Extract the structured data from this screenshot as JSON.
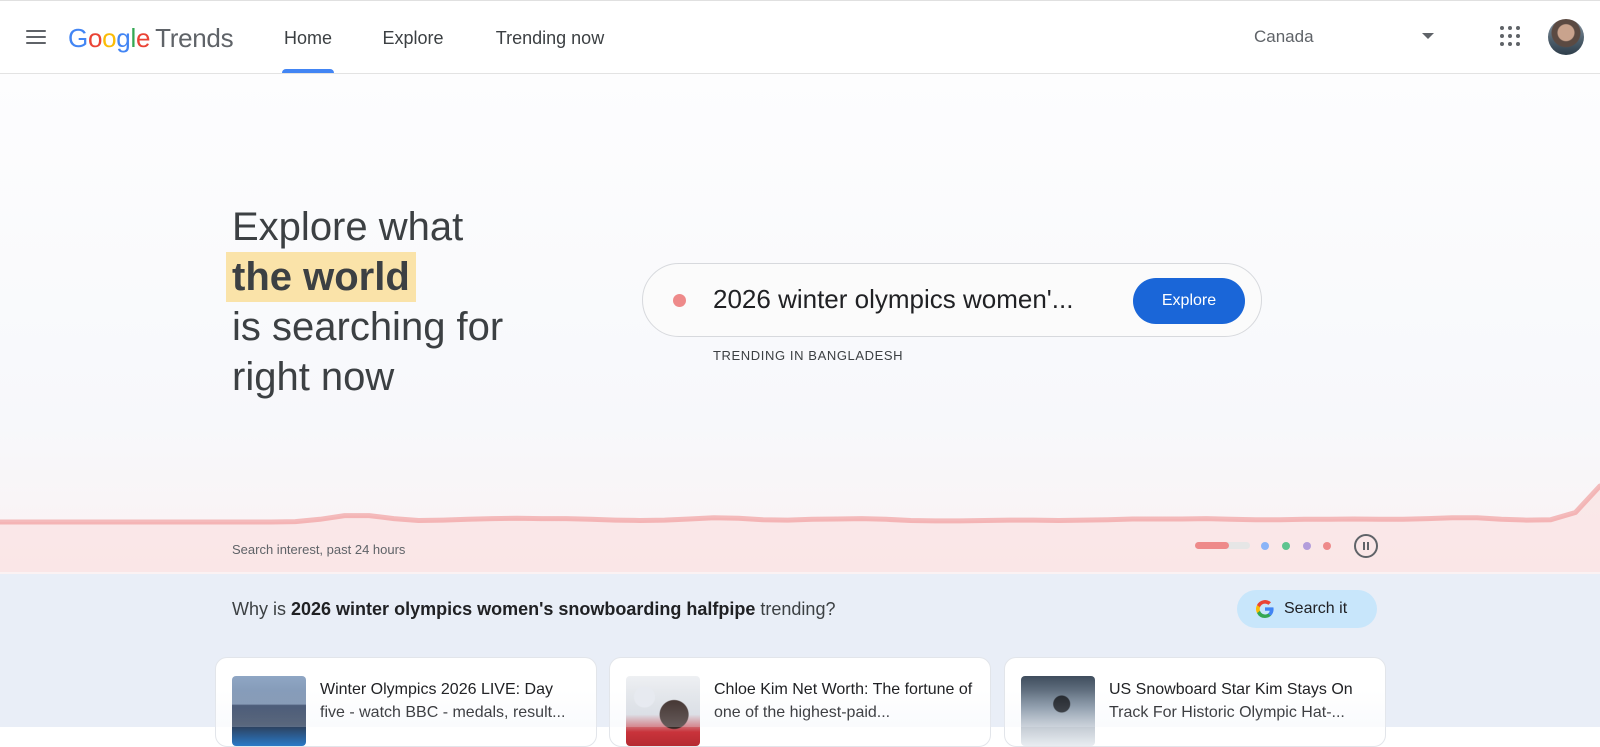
{
  "header": {
    "logo": {
      "google": "Google",
      "product": "Trends"
    },
    "tabs": [
      {
        "label": "Home",
        "active": true
      },
      {
        "label": "Explore",
        "active": false
      },
      {
        "label": "Trending now",
        "active": false
      }
    ],
    "country": "Canada",
    "icons": {
      "menu": "hamburger-menu-icon",
      "apps": "apps-grid-icon",
      "dropdown": "caret-down-icon"
    }
  },
  "hero": {
    "line1": "Explore what",
    "highlight": "the world",
    "line3": "is searching for",
    "line4": "right now",
    "search_term": "2026 winter olympics women'...",
    "explore_button": "Explore",
    "trending_caption": "TRENDING IN BANGLADESH",
    "chart_caption": "Search interest, past 24 hours",
    "colors": {
      "accent": "#1a66d8",
      "highlight": "#fae3a9",
      "series": "#ee8a8a"
    },
    "carousel": {
      "active_index": 0,
      "dot_colors": [
        "#8ab4f8",
        "#5ec48f",
        "#b39ddb",
        "#ee8a8a"
      ]
    }
  },
  "chart_data": {
    "type": "area",
    "series_color": "#ee8a8a",
    "values": [
      5,
      5,
      5,
      5,
      5,
      5,
      5,
      5,
      5,
      5,
      5,
      5,
      6,
      12,
      22,
      22,
      14,
      9,
      10,
      12,
      14,
      15,
      14,
      14,
      12,
      10,
      9,
      10,
      13,
      16,
      15,
      11,
      10,
      12,
      13,
      14,
      12,
      9,
      8,
      8,
      9,
      10,
      10,
      9,
      10,
      11,
      13,
      13,
      13,
      14,
      12,
      11,
      11,
      12,
      12,
      13,
      12,
      12,
      14,
      16,
      16,
      12,
      10,
      11,
      30,
      100
    ]
  },
  "why": {
    "prefix": "Why is ",
    "term": "2026 winter olympics women's snowboarding halfpipe",
    "suffix": " trending?",
    "search_it": "Search it",
    "articles": [
      {
        "title": "Winter Olympics 2026 LIVE: Day five - watch BBC - medals, result..."
      },
      {
        "title": "Chloe Kim Net Worth: The fortune of one of the highest-paid..."
      },
      {
        "title": "US Snowboard Star Kim Stays On Track For Historic Olympic Hat-..."
      }
    ]
  }
}
